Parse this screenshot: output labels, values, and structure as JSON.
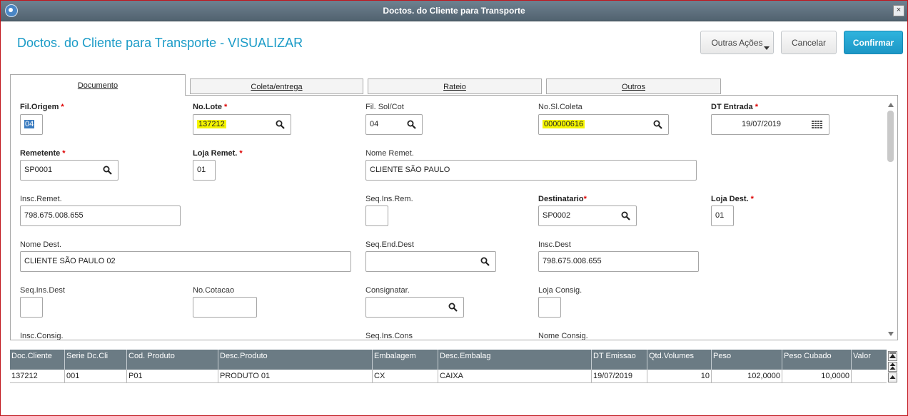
{
  "window": {
    "title": "Doctos. do Cliente para Transporte",
    "close_glyph": "×"
  },
  "header": {
    "title": "Doctos. do Cliente para Transporte - VISUALIZAR",
    "buttons": {
      "outras": "Outras Ações",
      "cancel": "Cancelar",
      "confirm": "Confirmar"
    }
  },
  "tabs": [
    "Documento",
    "Coleta/entrega",
    "Rateio",
    "Outros"
  ],
  "required_mark": "*",
  "form": {
    "fil_origem": {
      "label": "Fil.Origem",
      "value": "04"
    },
    "no_lote": {
      "label": "No.Lote",
      "value": "137212"
    },
    "fil_sol_cot": {
      "label": "Fil. Sol/Cot",
      "value": "04"
    },
    "no_sl_coleta": {
      "label": "No.Sl.Coleta",
      "value": "000000616"
    },
    "dt_entrada": {
      "label": "DT Entrada",
      "value": "19/07/2019"
    },
    "remetente": {
      "label": "Remetente",
      "value": "SP0001"
    },
    "loja_remet": {
      "label": "Loja Remet.",
      "value": "01"
    },
    "nome_remet": {
      "label": "Nome Remet.",
      "value": "CLIENTE SÃO PAULO"
    },
    "insc_remet": {
      "label": "Insc.Remet.",
      "value": "798.675.008.655"
    },
    "seq_ins_rem": {
      "label": "Seq.Ins.Rem.",
      "value": ""
    },
    "destinatario": {
      "label": "Destinatario",
      "value": "SP0002"
    },
    "loja_dest": {
      "label": "Loja Dest.",
      "value": "01"
    },
    "nome_dest": {
      "label": "Nome Dest.",
      "value": "CLIENTE SÃO PAULO 02"
    },
    "seq_end_dest": {
      "label": "Seq.End.Dest",
      "value": ""
    },
    "insc_dest": {
      "label": "Insc.Dest",
      "value": "798.675.008.655"
    },
    "seq_ins_dest": {
      "label": "Seq.Ins.Dest",
      "value": ""
    },
    "no_cotacao": {
      "label": "No.Cotacao",
      "value": ""
    },
    "consignatar": {
      "label": "Consignatar.",
      "value": ""
    },
    "loja_consig": {
      "label": "Loja Consig.",
      "value": ""
    },
    "insc_consig": {
      "label": "Insc.Consig."
    },
    "seq_ins_cons": {
      "label": "Seq.Ins.Cons"
    },
    "nome_consig": {
      "label": "Nome Consig."
    }
  },
  "grid": {
    "columns": [
      "Doc.Cliente",
      "Serie Dc.Cli",
      "Cod. Produto",
      "Desc.Produto",
      "Embalagem",
      "Desc.Embalag",
      "DT Emissao",
      "Qtd.Volumes",
      "Peso",
      "Peso Cubado",
      "Valor"
    ],
    "rows": [
      [
        "137212",
        "001",
        "P01",
        "PRODUTO 01",
        "CX",
        "CAIXA",
        "19/07/2019",
        "10",
        "102,0000",
        "10,0000",
        ""
      ]
    ]
  },
  "colors": {
    "accent": "#1a9bc7",
    "confirm": "#23a6d5",
    "highlight": "#f5f500",
    "grid_header": "#6b7b84"
  },
  "icons": [
    "app-icon",
    "search-icon",
    "calendar-icon",
    "close-icon",
    "dropdown-caret-icon",
    "scroll-arrow-icon"
  ]
}
